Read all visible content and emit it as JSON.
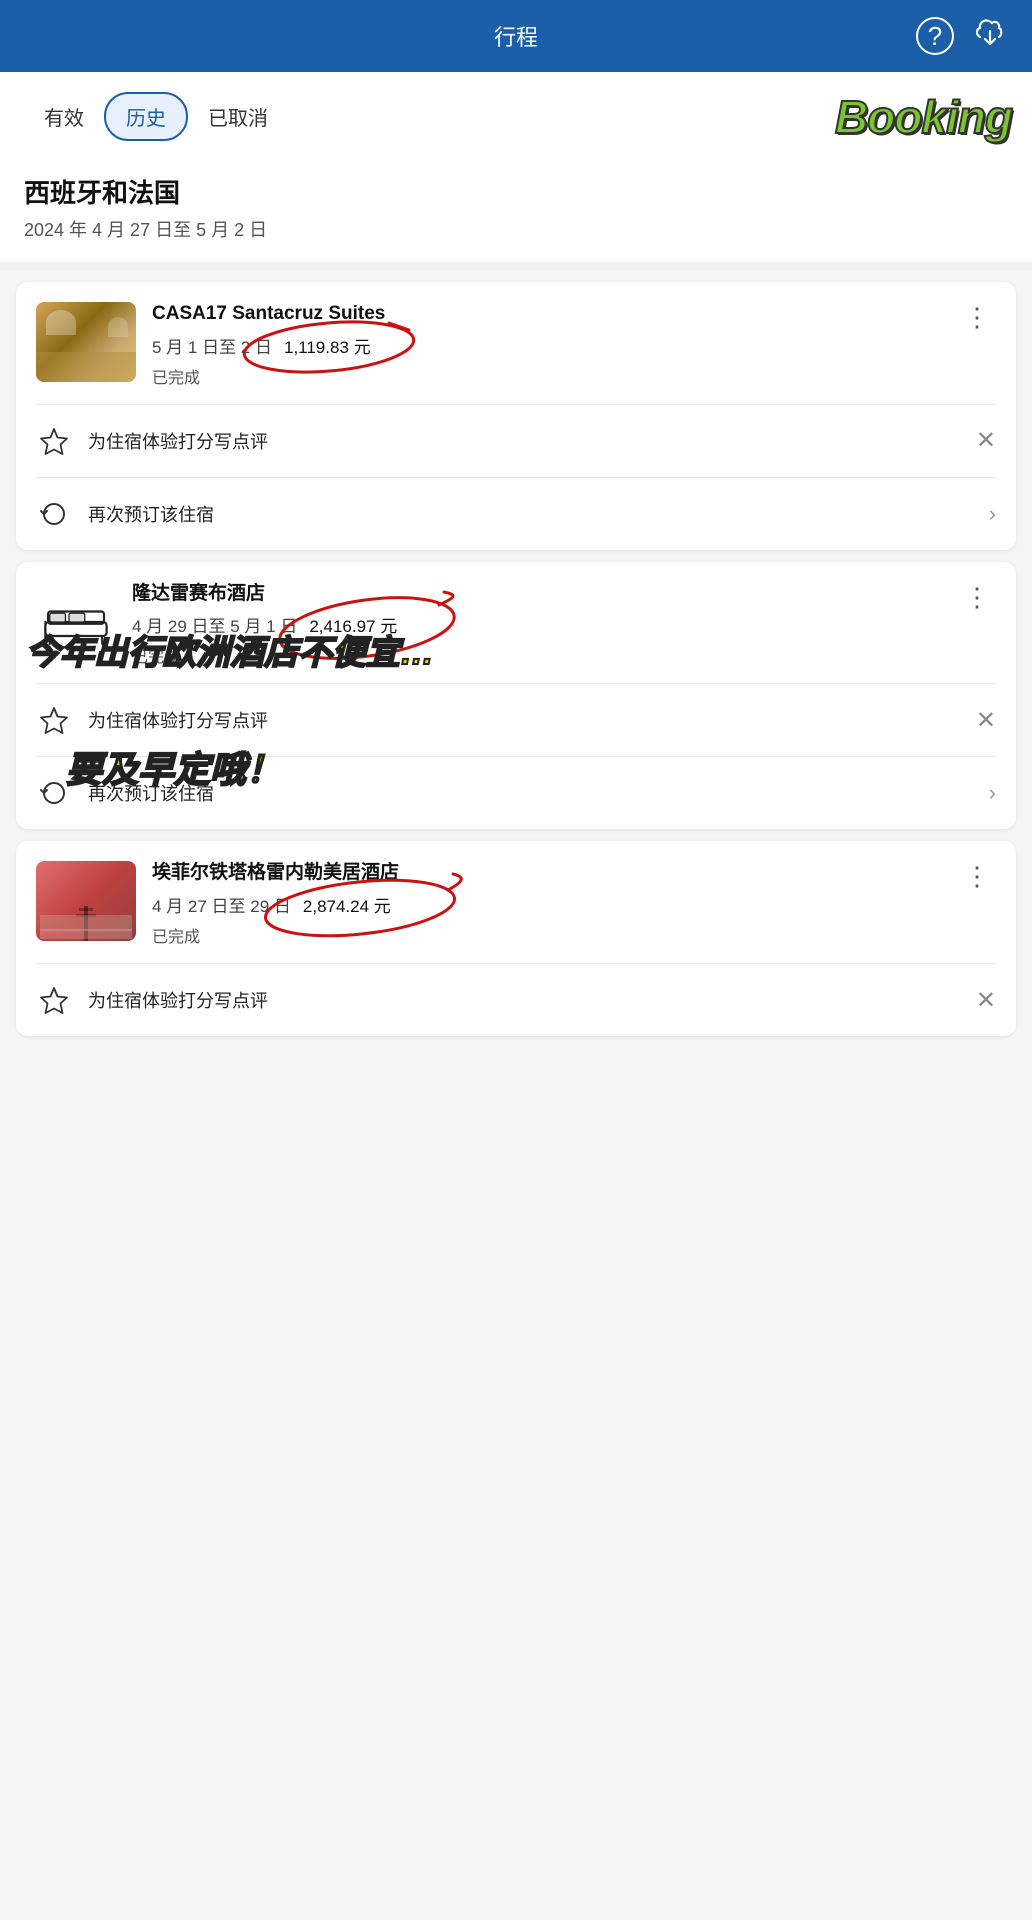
{
  "header": {
    "title": "行程",
    "help_icon": "?",
    "download_icon": "↓"
  },
  "tabs": {
    "items": [
      {
        "label": "有效",
        "active": false
      },
      {
        "label": "历史",
        "active": true
      },
      {
        "label": "已取消",
        "active": false
      }
    ],
    "logo": "Booking"
  },
  "trip": {
    "title": "西班牙和法国",
    "dates": "2024 年 4 月 27 日至 5 月 2 日"
  },
  "bookings": [
    {
      "id": "booking-1",
      "hotel_name": "CASA17 Santacruz Suites",
      "dates": "5 月 1 日至 2 日",
      "price": "1,119.83 元",
      "status": "已完成",
      "has_image": true,
      "image_type": "warm",
      "actions": [
        {
          "type": "review",
          "label": "为住宿体验打分写点评"
        },
        {
          "type": "rebook",
          "label": "再次预订该住宿"
        }
      ]
    },
    {
      "id": "booking-2",
      "hotel_name": "隆达雷赛布酒店",
      "dates": "4 月 29 日至 5 月 1 日",
      "price": "2,416.97 元",
      "status": "已完成",
      "has_image": false,
      "image_type": "bed-icon",
      "actions": [
        {
          "type": "review",
          "label": "为住宿体验打分写点评"
        },
        {
          "type": "rebook",
          "label": "再次预订该住宿"
        }
      ]
    },
    {
      "id": "booking-3",
      "hotel_name": "埃菲尔铁塔格雷内勒美居酒店",
      "dates": "4 月 27 日至 29 日",
      "price": "2,874.24 元",
      "status": "已完成",
      "has_image": true,
      "image_type": "red",
      "actions": [
        {
          "type": "review",
          "label": "为住宿体验打分写点评"
        }
      ]
    }
  ],
  "overlay": {
    "line1": "今年出行欧洲酒店不便宜…",
    "line2": "要及早定哦！"
  },
  "actions": {
    "review_label": "为住宿体验打分写点评",
    "rebook_label": "再次预订该住宿"
  }
}
